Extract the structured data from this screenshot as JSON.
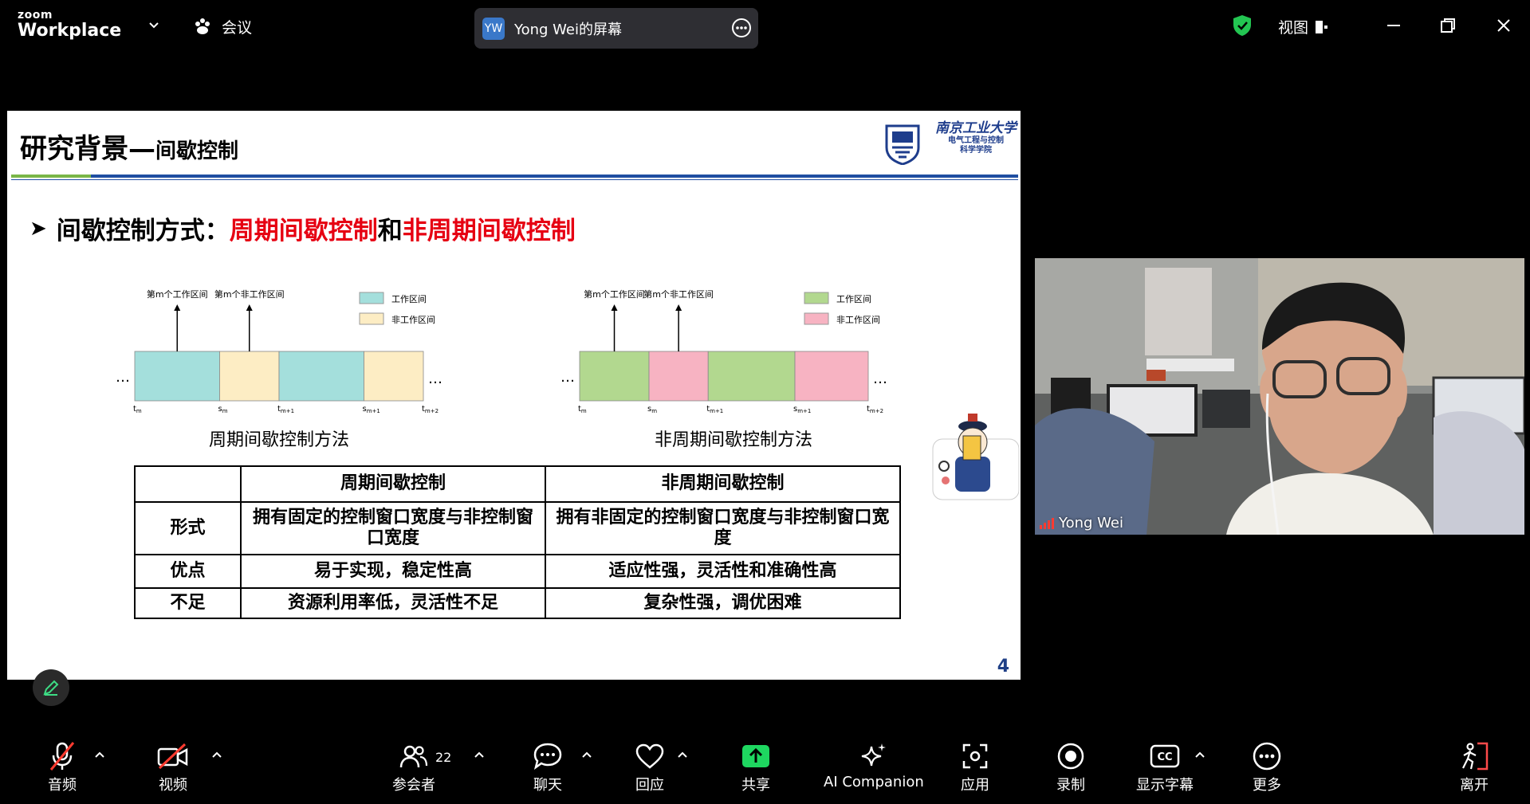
{
  "app": {
    "brand_top": "zoom",
    "brand_bottom": "Workplace",
    "meeting_menu_label": "会议",
    "share_banner": {
      "avatar_initials": "YW",
      "label": "Yong Wei的屏幕"
    },
    "view_label": "视图"
  },
  "slide": {
    "title_main": "研究背景—",
    "title_sub": "间歇控制",
    "logo": {
      "line1": "南京工业大学",
      "line2": "电气工程与控制",
      "line3": "科学学院"
    },
    "bullet_prefix": "间歇控制方式：",
    "bullet_red1": "周期间歇控制",
    "bullet_joiner": "和",
    "bullet_red2": "非周期间歇控制",
    "periodic_diagram": {
      "caption": "周期间歇控制方法",
      "arrow_label_1": "第m个工作区间",
      "arrow_label_2": "第m个非工作区间",
      "legend_work": "工作区间",
      "legend_rest": "非工作区间",
      "work_color": "#a4dfdc",
      "rest_color": "#fdedc4",
      "ellipsis": "…",
      "ticks": [
        "t",
        "s",
        "t",
        "s",
        "t"
      ],
      "tick_subs": [
        "m",
        "m",
        "m+1",
        "m+1",
        "m+2"
      ],
      "segment_widths": [
        1,
        0.7,
        1,
        0.7
      ]
    },
    "aperiodic_diagram": {
      "caption": "非周期间歇控制方法",
      "arrow_label_1": "第m个工作区间",
      "arrow_label_2": "第m个非工作区间",
      "legend_work": "工作区间",
      "legend_rest": "非工作区间",
      "work_color": "#b2d88f",
      "rest_color": "#f7b3c2",
      "ellipsis": "…",
      "ticks": [
        "t",
        "s",
        "t",
        "s",
        "t"
      ],
      "tick_subs": [
        "m",
        "m",
        "m+1",
        "m+1",
        "m+2"
      ],
      "segment_widths": [
        0.88,
        0.75,
        1.1,
        0.93
      ]
    },
    "table": {
      "headers": [
        "",
        "周期间歇控制",
        "非周期间歇控制"
      ],
      "rows": [
        {
          "label": "形式",
          "periodic": "拥有固定的控制窗口宽度与非控制窗口宽度",
          "aperiodic": "拥有非固定的控制窗口宽度与非控制窗口宽度"
        },
        {
          "label": "优点",
          "periodic": "易于实现，稳定性高",
          "aperiodic": "适应性强，灵活性和准确性高"
        },
        {
          "label": "不足",
          "periodic": "资源利用率低，灵活性不足",
          "aperiodic": "复杂性强，调优困难"
        }
      ]
    },
    "page_number": "4"
  },
  "video": {
    "participant_name": "Yong Wei"
  },
  "toolbar": {
    "audio": "音频",
    "video": "视频",
    "participants": "参会者",
    "participants_count": "22",
    "chat": "聊天",
    "reactions": "回应",
    "share": "共享",
    "ai_companion": "AI Companion",
    "apps": "应用",
    "record": "录制",
    "captions": "显示字幕",
    "more": "更多",
    "leave": "离开"
  },
  "colors": {
    "share_green": "#1ed760",
    "leave_red": "#ff4b4b",
    "mute_red": "#ff3b30",
    "title_red": "#e60012",
    "shield_green": "#23c552"
  }
}
